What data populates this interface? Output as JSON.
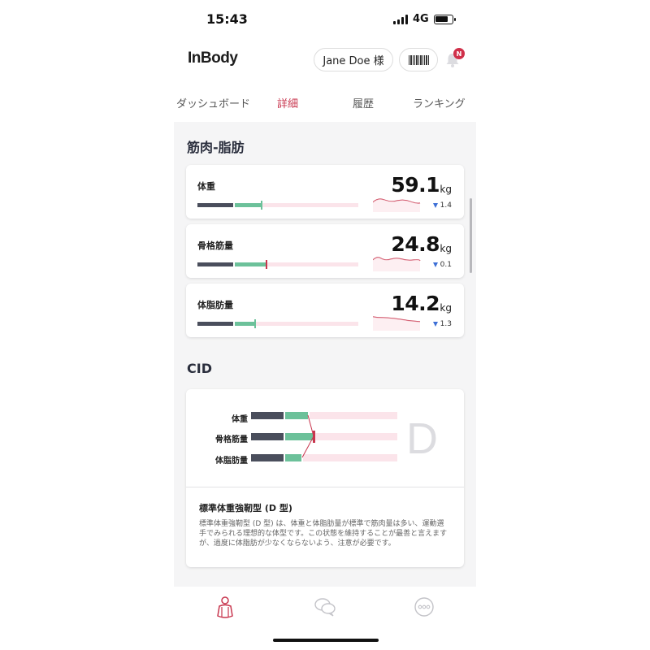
{
  "status_bar": {
    "time": "15:43",
    "network": "4G",
    "battery_level": 0.8
  },
  "header": {
    "logo": "InBody",
    "user_name": "Jane Doe 様",
    "notification_badge": "N"
  },
  "tabs": [
    {
      "label": "ダッシュボード",
      "active": false
    },
    {
      "label": "詳細",
      "active": true
    },
    {
      "label": "履歴",
      "active": false
    },
    {
      "label": "ランキング",
      "active": false
    }
  ],
  "muscle_fat": {
    "title": "筋肉-脂肪",
    "items": [
      {
        "label": "体重",
        "value": "59.1",
        "unit": "kg",
        "delta": "1.4",
        "trend": "down",
        "marker_color": "#6cc19a"
      },
      {
        "label": "骨格筋量",
        "value": "24.8",
        "unit": "kg",
        "delta": "0.1",
        "trend": "down",
        "marker_color": "#c8364e"
      },
      {
        "label": "体脂肪量",
        "value": "14.2",
        "unit": "kg",
        "delta": "1.3",
        "trend": "down",
        "marker_color": "#6cc19a"
      }
    ]
  },
  "cid": {
    "title": "CID",
    "rows": [
      "体重",
      "骨格筋量",
      "体脂肪量"
    ],
    "letter": "D",
    "type_title": "標準体重強靭型 (D 型)",
    "description": "標準体重強靭型 (D 型) は、体重と体脂肪量が標準で筋肉量は多い、運動選手でみられる理想的な体型です。この状態を維持することが最善と言えますが、過度に体脂肪が少なくならないよう、注意が必要です。"
  },
  "bottom_nav": [
    {
      "icon": "body-composition-icon",
      "active": true
    },
    {
      "icon": "chat-icon",
      "active": false
    },
    {
      "icon": "more-icon",
      "active": false
    }
  ],
  "colors": {
    "accent": "#c8364e",
    "dark_segment": "#4a4e5c",
    "normal_segment": "#6cc19a",
    "over_segment": "#fbe4ea",
    "trend_line": "#c8364e",
    "delta_arrow": "#3d6fd6"
  }
}
